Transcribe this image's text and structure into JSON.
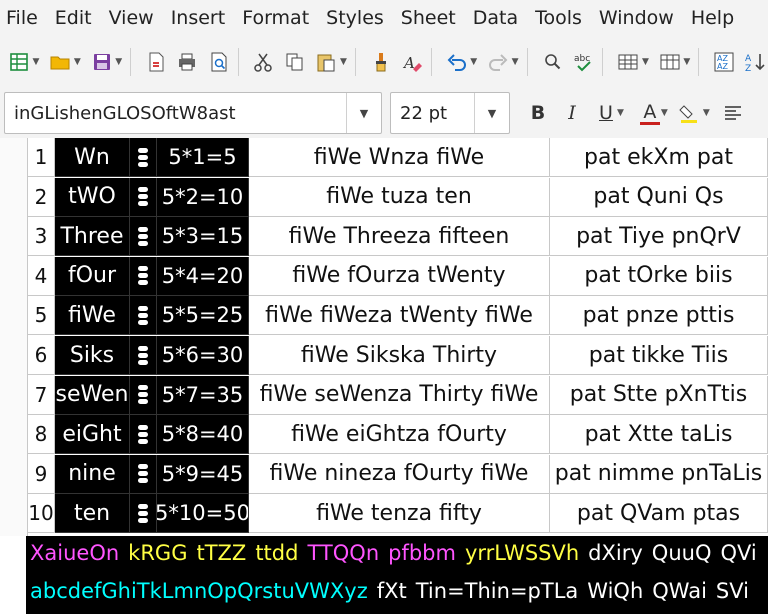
{
  "menu": [
    "File",
    "Edit",
    "View",
    "Insert",
    "Format",
    "Styles",
    "Sheet",
    "Data",
    "Tools",
    "Window",
    "Help"
  ],
  "toolbar": {
    "icons": [
      "new-spreadsheet-icon",
      "open-folder-icon",
      "save-icon",
      "export-pdf-icon",
      "print-icon",
      "print-preview-icon",
      "cut-icon",
      "copy-icon",
      "paste-icon",
      "clone-format-icon",
      "clear-format-icon",
      "undo-icon",
      "redo-icon",
      "find-replace-icon",
      "spellcheck-icon",
      "row-icon",
      "column-icon",
      "sort-icon",
      "sort-ascending-icon"
    ]
  },
  "format_bar": {
    "font_name": "inGLishenGLOSOftW8ast",
    "font_size": "22 pt",
    "bold": "B",
    "italic": "I",
    "underline": "U",
    "font_color": "A"
  },
  "rows": [
    {
      "num": "1",
      "en": "Wn",
      "eq": "5*1=5",
      "phrase": "fiWe Wnza fiWe",
      "trans": "pat ekXm pat"
    },
    {
      "num": "2",
      "en": "tWO",
      "eq": "5*2=10",
      "phrase": "fiWe tuza ten",
      "trans": "pat Quni Qs"
    },
    {
      "num": "3",
      "en": "Three",
      "eq": "5*3=15",
      "phrase": "fiWe Threeza fifteen",
      "trans": "pat Tiye pnQrV"
    },
    {
      "num": "4",
      "en": "fOur",
      "eq": "5*4=20",
      "phrase": "fiWe fOurza tWenty",
      "trans": "pat tOrke biis"
    },
    {
      "num": "5",
      "en": "fiWe",
      "eq": "5*5=25",
      "phrase": "fiWe fiWeza tWenty fiWe",
      "trans": "pat pnze pttis"
    },
    {
      "num": "6",
      "en": "Siks",
      "eq": "5*6=30",
      "phrase": "fiWe Sikska Thirty",
      "trans": "pat tikke Tiis"
    },
    {
      "num": "7",
      "en": "seWen",
      "eq": "5*7=35",
      "phrase": "fiWe seWenza Thirty fiWe",
      "trans": "pat Stte pXnTtis"
    },
    {
      "num": "8",
      "en": "eiGht",
      "eq": "5*8=40",
      "phrase": "fiWe eiGhtza fOurty",
      "trans": "pat Xtte taLis"
    },
    {
      "num": "9",
      "en": "nine",
      "eq": "5*9=45",
      "phrase": "fiWe nineza fOurty fiWe",
      "trans": "pat nimme pnTaLis"
    },
    {
      "num": "10",
      "en": "ten",
      "eq": "5*10=50",
      "phrase": "fiWe tenza fifty",
      "trans": "pat QVam ptas"
    }
  ],
  "banner": {
    "line1": [
      {
        "text": "XaiueOn",
        "color": "#ff55ff"
      },
      {
        "text": "kRGG",
        "color": "#ffff44"
      },
      {
        "text": "tTZZ",
        "color": "#ffff44"
      },
      {
        "text": "ttdd",
        "color": "#ffff44"
      },
      {
        "text": "TTQQn",
        "color": "#ff55ff"
      },
      {
        "text": "pfbbm",
        "color": "#ff55ff"
      },
      {
        "text": "yrrLWSSVh",
        "color": "#ffff44"
      },
      {
        "text": "dXiry",
        "color": "#ffffff"
      },
      {
        "text": "QuuQ",
        "color": "#ffffff"
      },
      {
        "text": "QVi",
        "color": "#ffffff"
      }
    ],
    "line2": [
      {
        "text": "abcdefGhiTkLmnOpQrstuVWXyz",
        "color": "#00ffff"
      },
      {
        "text": "fXt",
        "color": "#ffffff"
      },
      {
        "text": "Tin=Thin=pTLa",
        "color": "#ffffff"
      },
      {
        "text": "WiQh",
        "color": "#ffffff"
      },
      {
        "text": "QWai",
        "color": "#ffffff"
      },
      {
        "text": "SVi",
        "color": "#ffffff"
      }
    ]
  }
}
